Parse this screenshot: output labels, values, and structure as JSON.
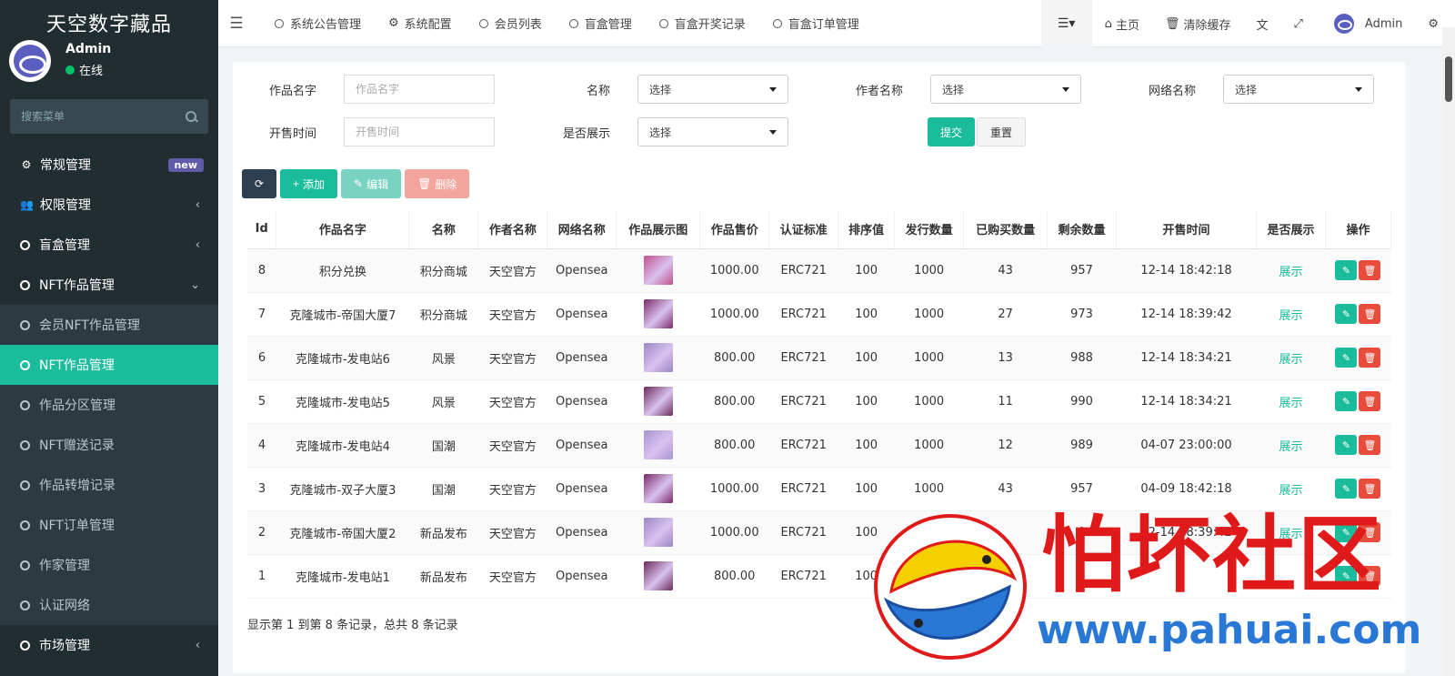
{
  "brand": "天空数字藏品",
  "user": {
    "name": "Admin",
    "status": "在线"
  },
  "sidebar_search": {
    "placeholder": "搜索菜单"
  },
  "sidebar": {
    "items": [
      {
        "label": "常规管理",
        "badge": "new",
        "type": "top"
      },
      {
        "label": "权限管理",
        "type": "top"
      },
      {
        "label": "盲盒管理",
        "type": "top"
      },
      {
        "label": "NFT作品管理",
        "type": "top-open"
      },
      {
        "label": "会员NFT作品管理",
        "type": "sub"
      },
      {
        "label": "NFT作品管理",
        "type": "active"
      },
      {
        "label": "作品分区管理",
        "type": "sub"
      },
      {
        "label": "NFT赠送记录",
        "type": "sub"
      },
      {
        "label": "作品转增记录",
        "type": "sub"
      },
      {
        "label": "NFT订单管理",
        "type": "sub"
      },
      {
        "label": "作家管理",
        "type": "sub"
      },
      {
        "label": "认证网络",
        "type": "sub"
      },
      {
        "label": "市场管理",
        "type": "top"
      }
    ]
  },
  "topnav": {
    "tabs": [
      "系统公告管理",
      "系统配置",
      "会员列表",
      "盲盒管理",
      "盲盒开奖记录",
      "盲盒订单管理"
    ],
    "home": "主页",
    "clear_cache": "清除缓存",
    "admin": "Admin"
  },
  "filters": {
    "work_name_label": "作品名字",
    "work_name_placeholder": "作品名字",
    "name_label": "名称",
    "author_label": "作者名称",
    "network_label": "网络名称",
    "sale_time_label": "开售时间",
    "sale_time_placeholder": "开售时间",
    "show_label": "是否展示",
    "select_text": "选择",
    "submit": "提交",
    "reset": "重置"
  },
  "toolbar": {
    "add": "添加",
    "edit": "编辑",
    "delete": "删除"
  },
  "table": {
    "headers": [
      "Id",
      "作品名字",
      "名称",
      "作者名称",
      "网络名称",
      "作品展示图",
      "作品售价",
      "认证标准",
      "排序值",
      "发行数量",
      "已购买数量",
      "剩余数量",
      "开售时间",
      "是否展示",
      "操作"
    ],
    "rows": [
      {
        "id": "8",
        "work": "积分兑换",
        "name": "积分商城",
        "author": "天空官方",
        "network": "Opensea",
        "price": "1000.00",
        "standard": "ERC721",
        "sort": "100",
        "issued": "1000",
        "bought": "43",
        "remain": "957",
        "time": "12-14 18:42:18",
        "show": "展示",
        "thumb": "#c0508a"
      },
      {
        "id": "7",
        "work": "克隆城市-帝国大厦7",
        "name": "积分商城",
        "author": "天空官方",
        "network": "Opensea",
        "price": "1000.00",
        "standard": "ERC721",
        "sort": "100",
        "issued": "1000",
        "bought": "27",
        "remain": "973",
        "time": "12-14 18:39:42",
        "show": "展示",
        "thumb": "#7a2a6a"
      },
      {
        "id": "6",
        "work": "克隆城市-发电站6",
        "name": "风景",
        "author": "天空官方",
        "network": "Opensea",
        "price": "800.00",
        "standard": "ERC721",
        "sort": "100",
        "issued": "1000",
        "bought": "13",
        "remain": "988",
        "time": "12-14 18:34:21",
        "show": "展示",
        "thumb": "#9a86c4"
      },
      {
        "id": "5",
        "work": "克隆城市-发电站5",
        "name": "风景",
        "author": "天空官方",
        "network": "Opensea",
        "price": "800.00",
        "standard": "ERC721",
        "sort": "100",
        "issued": "1000",
        "bought": "11",
        "remain": "990",
        "time": "12-14 18:34:21",
        "show": "展示",
        "thumb": "#6a2a5a"
      },
      {
        "id": "4",
        "work": "克隆城市-发电站4",
        "name": "国潮",
        "author": "天空官方",
        "network": "Opensea",
        "price": "800.00",
        "standard": "ERC721",
        "sort": "100",
        "issued": "1000",
        "bought": "12",
        "remain": "989",
        "time": "04-07 23:00:00",
        "show": "展示",
        "thumb": "#a694cf"
      },
      {
        "id": "3",
        "work": "克隆城市-双子大厦3",
        "name": "国潮",
        "author": "天空官方",
        "network": "Opensea",
        "price": "1000.00",
        "standard": "ERC721",
        "sort": "100",
        "issued": "1000",
        "bought": "43",
        "remain": "957",
        "time": "04-09 18:42:18",
        "show": "展示",
        "thumb": "#7a2a6a"
      },
      {
        "id": "2",
        "work": "克隆城市-帝国大厦2",
        "name": "新品发布",
        "author": "天空官方",
        "network": "Opensea",
        "price": "1000.00",
        "standard": "ERC721",
        "sort": "100",
        "issued": "1000",
        "bought": "",
        "remain": "0",
        "time": "12-14 18:39:42",
        "show": "展示",
        "thumb": "#9a86c4"
      },
      {
        "id": "1",
        "work": "克隆城市-发电站1",
        "name": "新品发布",
        "author": "天空官方",
        "network": "Opensea",
        "price": "800.00",
        "standard": "ERC721",
        "sort": "100",
        "issued": "",
        "bought": "",
        "remain": "",
        "time": "",
        "show": "",
        "thumb": "#6a2a5a"
      }
    ]
  },
  "footer": {
    "info": "显示第 1 到第 8 条记录，总共 8 条记录"
  },
  "watermark": {
    "title": "怕坏社区",
    "url": "www.pahuai.com"
  },
  "colors": {
    "accent": "#1abc9c",
    "sidebar": "#222d32",
    "danger": "#e74c3c",
    "watermark_red": "#e01a1a",
    "watermark_blue": "#2a78d6"
  }
}
